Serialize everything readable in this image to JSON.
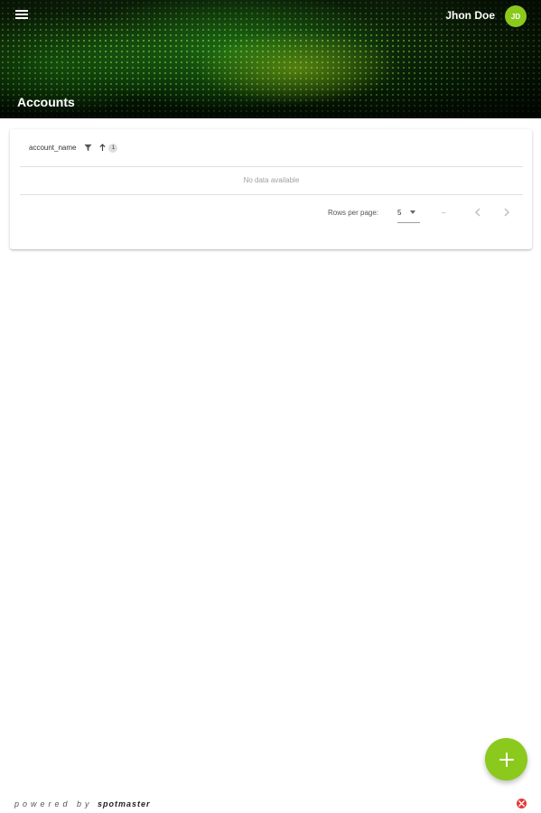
{
  "header": {
    "user_name": "Jhon Doe",
    "avatar_initials": "JD",
    "page_title": "Accounts"
  },
  "table": {
    "columns": [
      {
        "label": "account_name",
        "sort_order": "1"
      }
    ],
    "empty_text": "No data available",
    "rows_per_page_label": "Rows per page:",
    "rows_per_page_value": "5",
    "range_text": "–"
  },
  "footer": {
    "powered_by": "powered by",
    "brand": "spotmaster"
  },
  "colors": {
    "accent": "#8bc91d",
    "close": "#e53935"
  },
  "icons": {
    "menu": "menu-icon",
    "filter": "filter-icon",
    "sort": "arrow-up-icon",
    "prev": "chevron-left-icon",
    "next": "chevron-right-icon",
    "add": "plus-icon",
    "close": "close-icon"
  }
}
